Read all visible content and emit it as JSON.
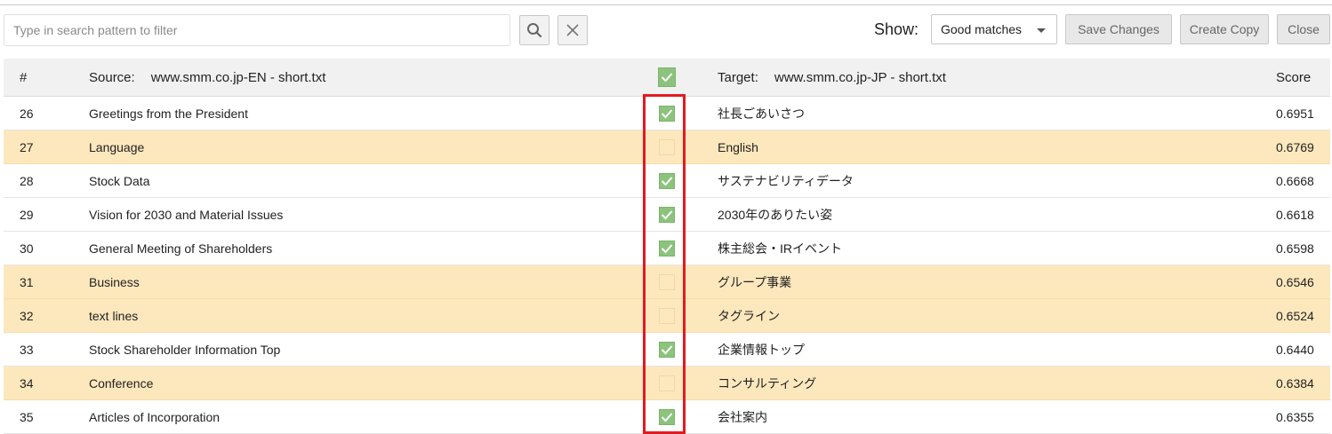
{
  "toolbar": {
    "search_placeholder": "Type in search pattern to filter",
    "search_value": "",
    "show_label": "Show:",
    "show_selected": "Good matches",
    "save_label": "Save Changes",
    "copy_label": "Create Copy",
    "close_label": "Close"
  },
  "table": {
    "header": {
      "num": "#",
      "source_label": "Source:",
      "source_file": "www.smm.co.jp-EN - short.txt",
      "all_checked": true,
      "target_label": "Target:",
      "target_file": "www.smm.co.jp-JP - short.txt",
      "score": "Score"
    },
    "rows": [
      {
        "num": "26",
        "source": "Greetings from the President",
        "checked": true,
        "target": "社長ごあいさつ",
        "score": "0.6951"
      },
      {
        "num": "27",
        "source": "Language",
        "checked": false,
        "target": "English",
        "score": "0.6769"
      },
      {
        "num": "28",
        "source": "Stock Data",
        "checked": true,
        "target": "サステナビリティデータ",
        "score": "0.6668"
      },
      {
        "num": "29",
        "source": "Vision for 2030 and Material Issues",
        "checked": true,
        "target": "2030年のありたい姿",
        "score": "0.6618"
      },
      {
        "num": "30",
        "source": "General Meeting of Shareholders",
        "checked": true,
        "target": "株主総会・IRイベント",
        "score": "0.6598"
      },
      {
        "num": "31",
        "source": "Business",
        "checked": false,
        "target": "グループ事業",
        "score": "0.6546"
      },
      {
        "num": "32",
        "source": "text lines",
        "checked": false,
        "target": "タグライン",
        "score": "0.6524"
      },
      {
        "num": "33",
        "source": "Stock Shareholder Information Top",
        "checked": true,
        "target": "企業情報トップ",
        "score": "0.6440"
      },
      {
        "num": "34",
        "source": "Conference",
        "checked": false,
        "target": "コンサルティング",
        "score": "0.6384"
      },
      {
        "num": "35",
        "source": "Articles of Incorporation",
        "checked": true,
        "target": "会社案内",
        "score": "0.6355"
      }
    ]
  },
  "colors": {
    "checked": "#8cc37d",
    "unchecked_row": "#fde8bd",
    "highlight_box": "#e11b22"
  }
}
